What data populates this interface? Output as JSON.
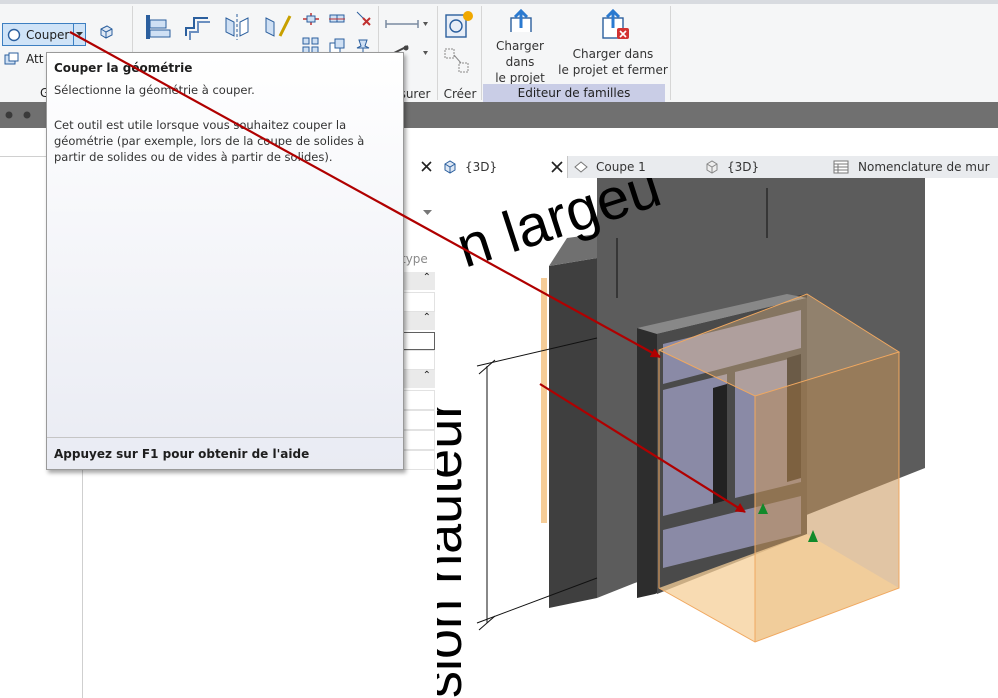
{
  "ribbon": {
    "couper_label": "Couper",
    "attacher_label": "Att",
    "group_label_left": "G",
    "group_label_mesurer": "surer",
    "group_label_creer": "Créer",
    "editeur_panel_label": "Editeur de familles",
    "load_project_label_1": "Charger dans",
    "load_project_label_2": "le projet",
    "load_close_label_1": "Charger dans",
    "load_close_label_2": "le projet et fermer"
  },
  "tooltip": {
    "title": "Couper la géométrie",
    "subtitle": "Sélectionne la géométrie à couper.",
    "description": "Cet outil est utile lorsque vous souhaitez couper la géométrie (par exemple, lors de la coupe de solides à partir de solides ou de vides à partir de solides).",
    "help": "Appuyez sur F1 pour obtenir de l'aide"
  },
  "properties": {
    "type_label": "type"
  },
  "tabs": [
    {
      "label": "{3D}",
      "icon": "3d-view-icon",
      "active": true
    },
    {
      "label": "Coupe 1",
      "icon": "section-view-icon"
    },
    {
      "label": "{3D}",
      "icon": "3d-view-icon"
    },
    {
      "label": "Nomenclature de mur",
      "icon": "schedule-icon"
    }
  ],
  "viewport": {
    "text_top": "n largeu",
    "text_left": "sion hauteur"
  },
  "colors": {
    "arrow": "#b00000",
    "wall": "#5a5a5a",
    "glass": "#8a8aa6",
    "highlight": "#f4c78c"
  }
}
